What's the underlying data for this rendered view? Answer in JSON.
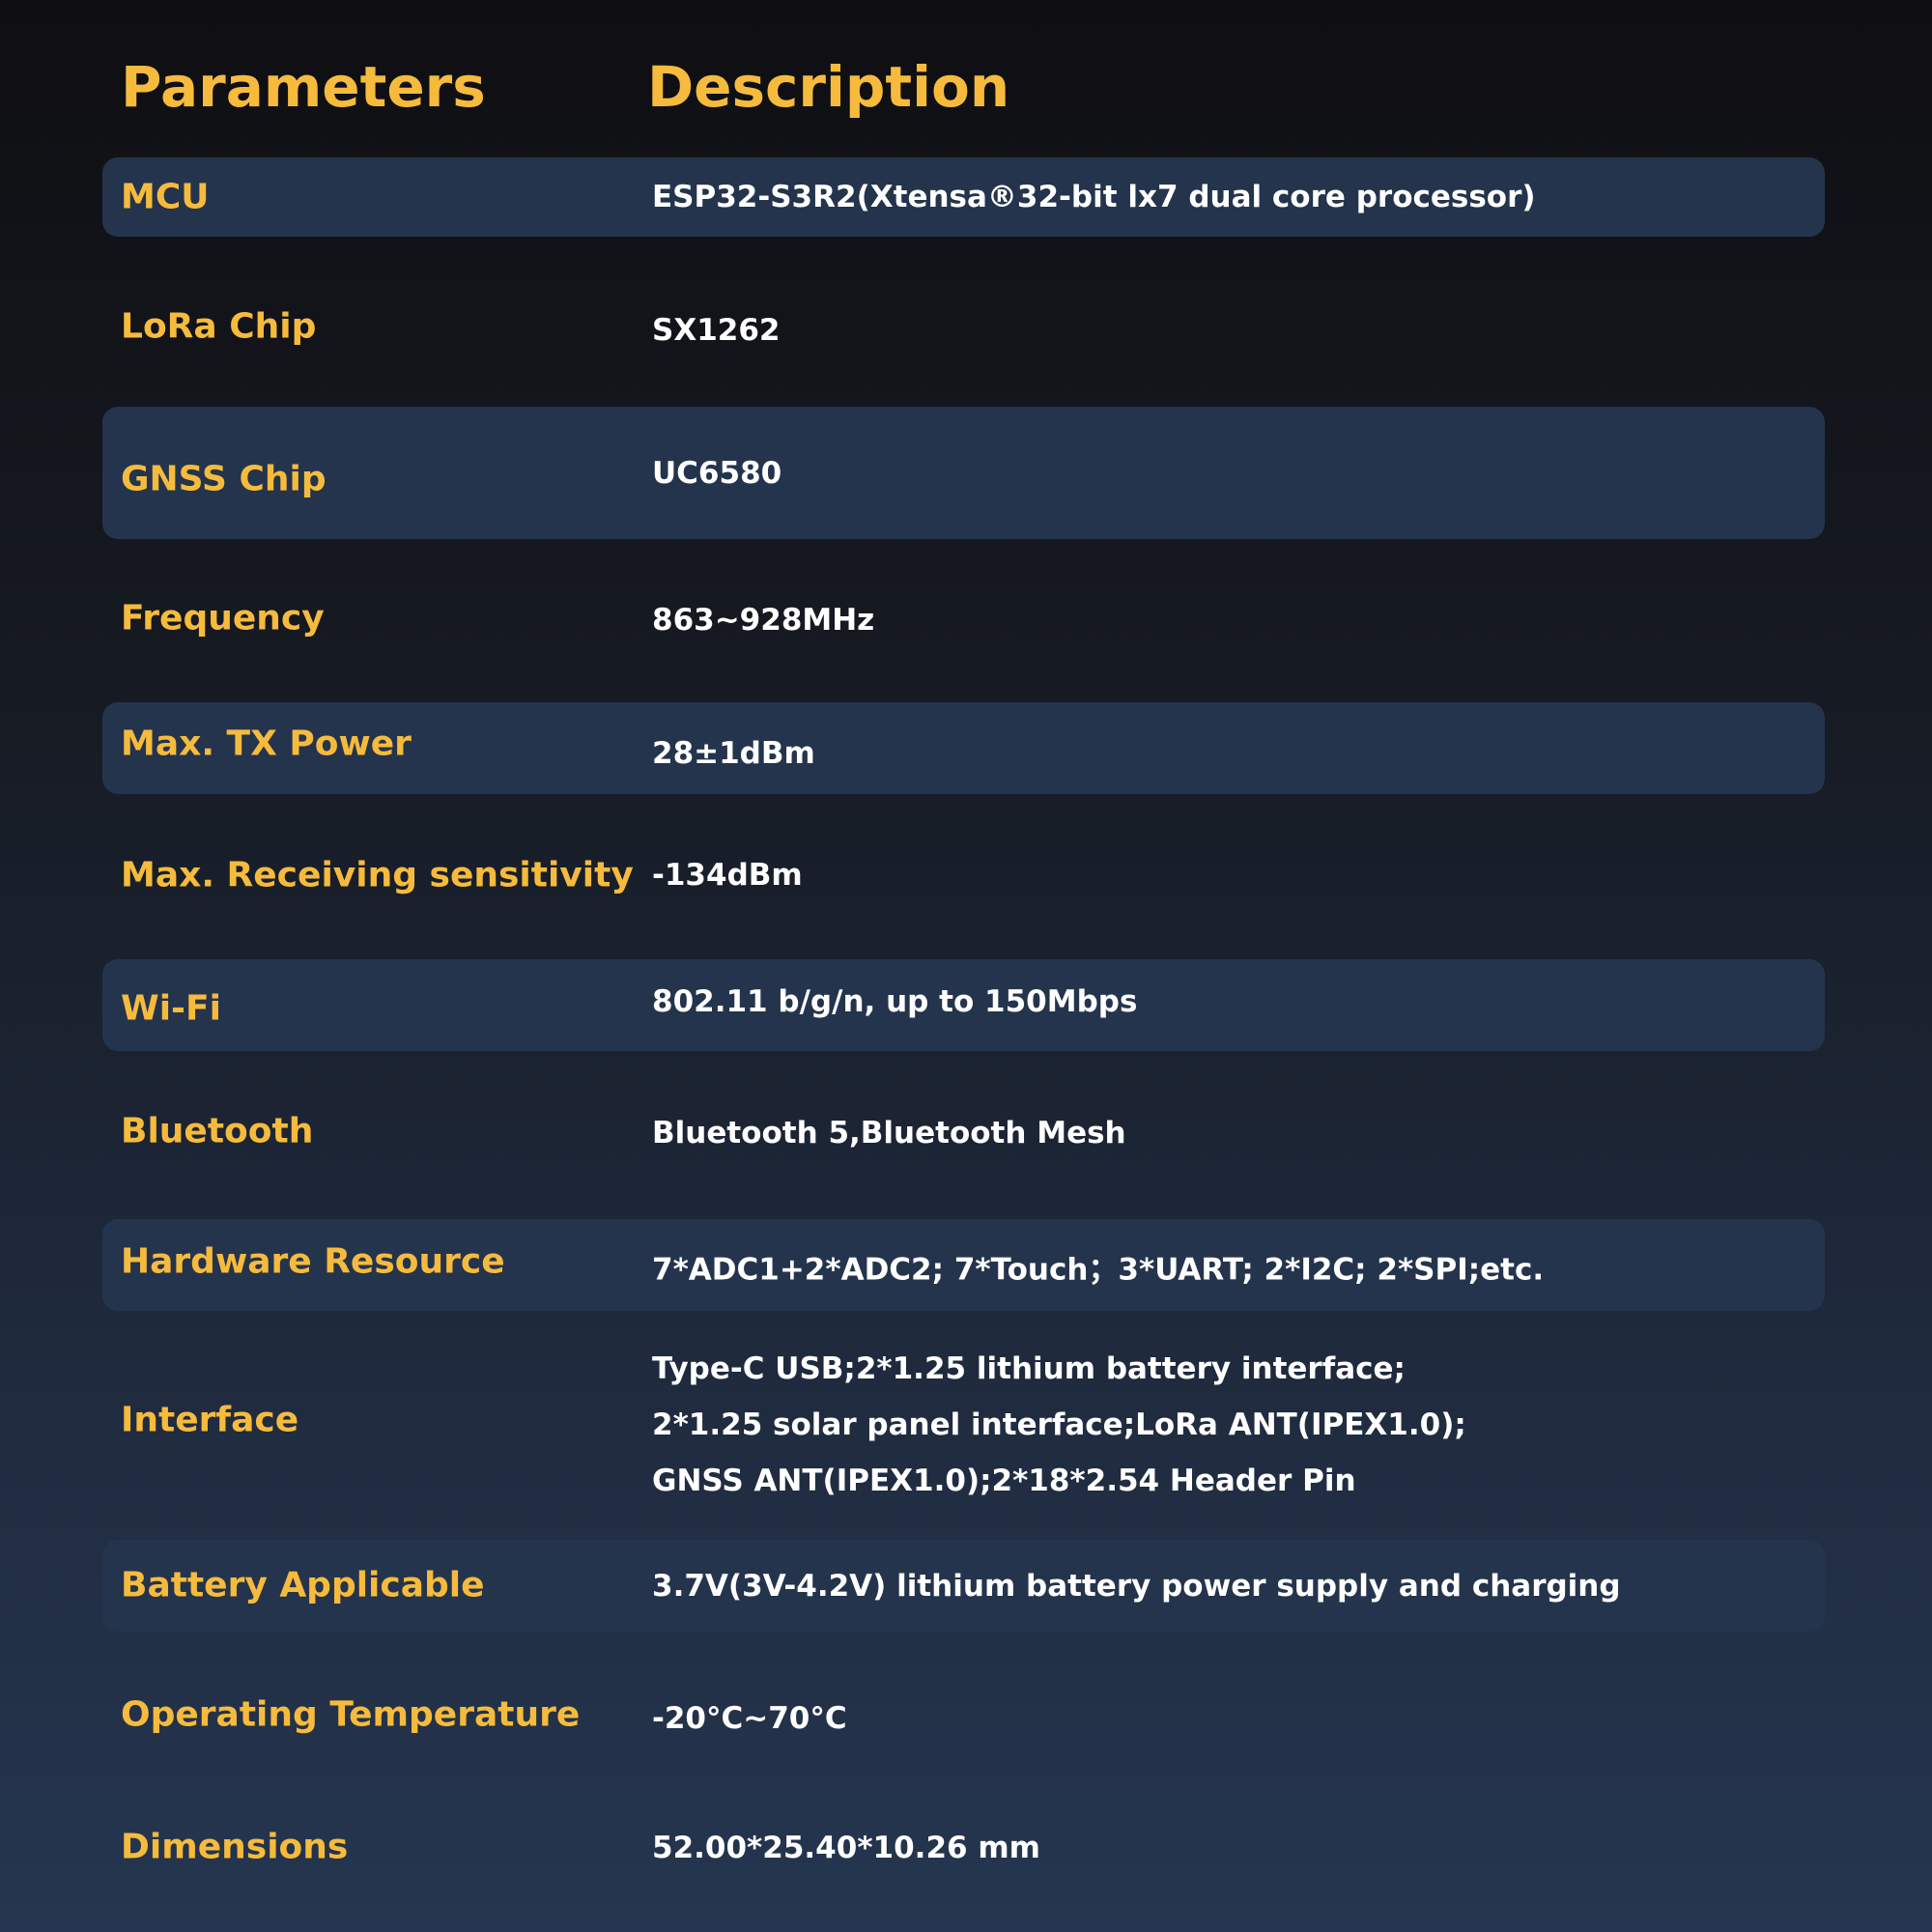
{
  "header": {
    "parameters": "Parameters",
    "description": "Description"
  },
  "rows": [
    {
      "label": "MCU",
      "value": "ESP32-S3R2(Xtensa®32-bit lx7 dual core processor)"
    },
    {
      "label": "LoRa Chip",
      "value": "SX1262"
    },
    {
      "label": "GNSS Chip",
      "value": "UC6580"
    },
    {
      "label": "Frequency",
      "value": "863~928MHz"
    },
    {
      "label": "Max. TX Power",
      "value": "28±1dBm"
    },
    {
      "label": "Max. Receiving sensitivity",
      "value": "-134dBm"
    },
    {
      "label": "Wi-Fi",
      "value": "802.11 b/g/n, up to 150Mbps"
    },
    {
      "label": "Bluetooth",
      "value": "Bluetooth 5,Bluetooth Mesh"
    },
    {
      "label": "Hardware Resource",
      "value": "7*ADC1+2*ADC2; 7*Touch；3*UART; 2*I2C; 2*SPI;etc."
    },
    {
      "label": "Interface",
      "lines": [
        "Type-C USB;2*1.25 lithium battery interface;",
        "2*1.25 solar panel interface;LoRa ANT(IPEX1.0);",
        "GNSS ANT(IPEX1.0);2*18*2.54 Header Pin"
      ]
    },
    {
      "label": "Battery Applicable",
      "value": "3.7V(3V-4.2V) lithium battery power supply and charging"
    },
    {
      "label": "Operating Temperature",
      "value": "-20°C~70°C"
    },
    {
      "label": "Dimensions",
      "value": "52.00*25.40*10.26 mm"
    }
  ]
}
